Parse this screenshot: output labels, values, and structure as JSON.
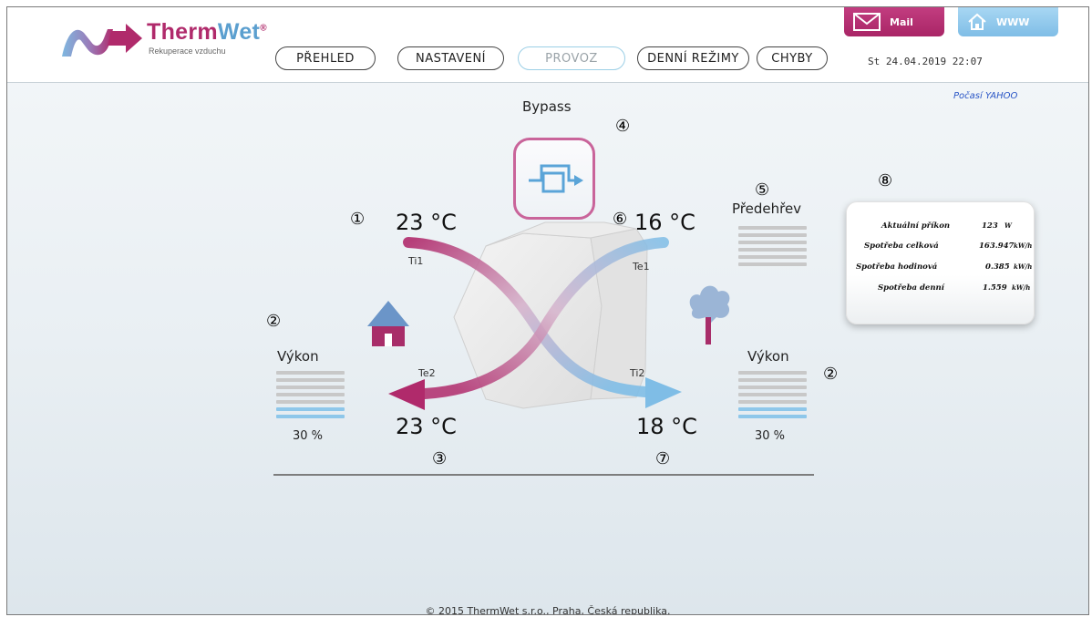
{
  "header": {
    "logo_title_a": "Therm",
    "logo_title_b": "Wet",
    "logo_reg": "®",
    "logo_subtitle": "Rekuperace vzduchu",
    "nav": [
      "PŘEHLED",
      "NASTAVENÍ",
      "PROVOZ",
      "DENNÍ REŽIMY",
      "CHYBY"
    ],
    "active_nav": "PROVOZ",
    "datetime": "St 24.04.2019  22:07",
    "mail_label": "Mail",
    "www_label": "WWW"
  },
  "weather_link": "Počasí YAHOO",
  "diagram": {
    "bypass_label": "Bypass",
    "preheat_label": "Předehřev",
    "temps": {
      "ti1": "23 °C",
      "te1": "16 °C",
      "te2": "23 °C",
      "ti2": "18 °C"
    },
    "sensors": {
      "ti1": "Ti1",
      "te1": "Te1",
      "te2": "Te2",
      "ti2": "Ti2"
    },
    "markers": [
      "①",
      "②",
      "③",
      "④",
      "⑤",
      "⑥",
      "⑦",
      "⑧"
    ],
    "left_fan": {
      "label": "Výkon",
      "percent": "30 %",
      "level": 0.3
    },
    "right_fan": {
      "label": "Výkon",
      "percent": "30 %",
      "level": 0.3
    }
  },
  "consumption": [
    {
      "label": "Aktuální příkon",
      "value": "123",
      "unit": "W"
    },
    {
      "label": "Spotřeba celková",
      "value": "163.947",
      "unit": "kW/h"
    },
    {
      "label": "Spotřeba hodinová",
      "value": "0.385",
      "unit": "kW/h"
    },
    {
      "label": "Spotřeba denní",
      "value": "1.559",
      "unit": "kW/h"
    }
  ],
  "footer": "© 2015 ThermWet s.r.o., Praha, Česká republika.",
  "colors": {
    "magenta": "#b02a6b",
    "blue": "#7fbde6"
  }
}
